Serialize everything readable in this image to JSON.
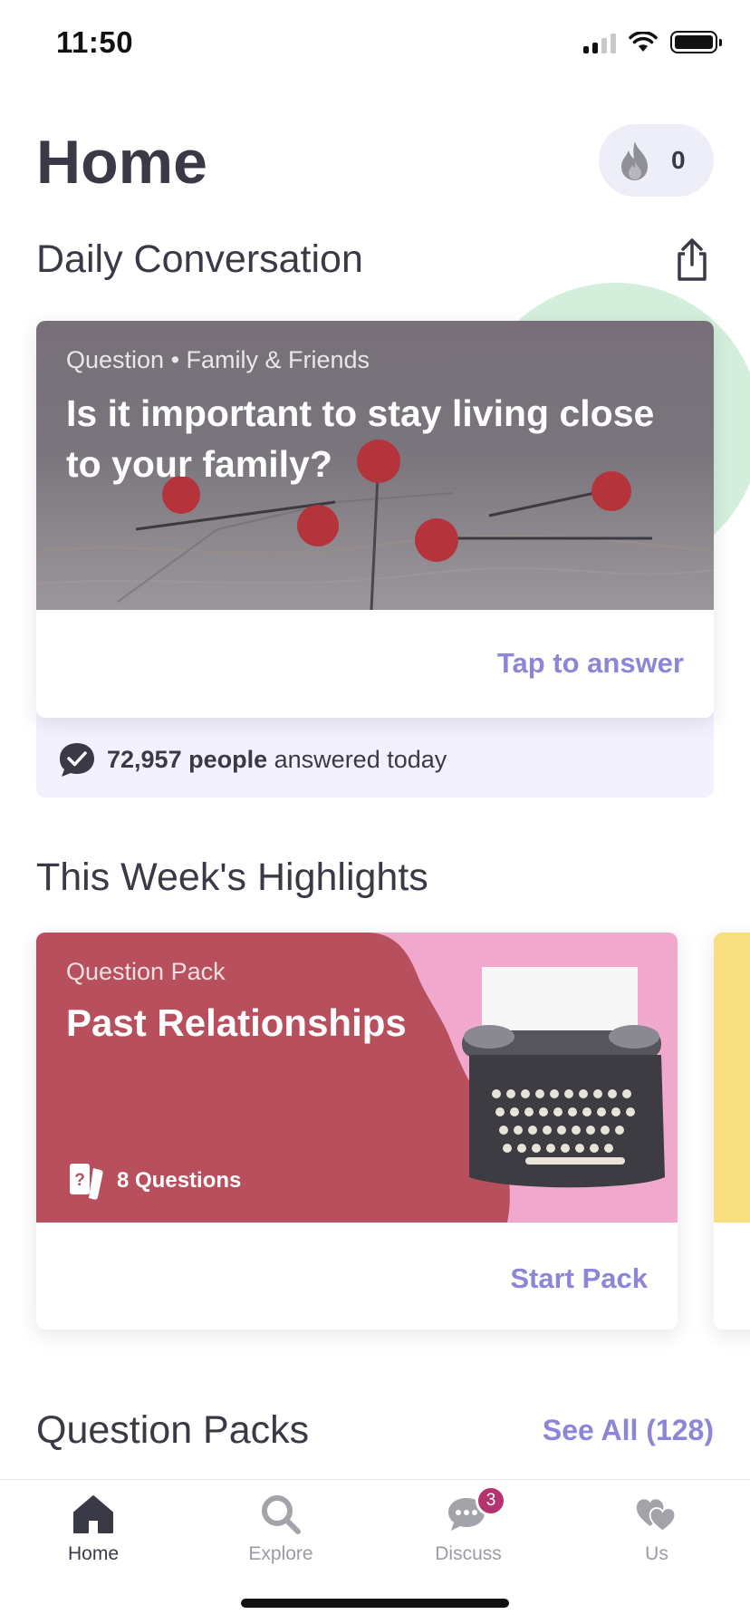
{
  "status_bar": {
    "time": "11:50"
  },
  "header": {
    "title": "Home",
    "streak_count": "0"
  },
  "daily": {
    "section_title": "Daily Conversation",
    "meta": "Question • Family & Friends",
    "question": "Is it important to stay living close to your family?",
    "cta": "Tap to answer",
    "answered_count": "72,957",
    "answered_unit": "people",
    "answered_suffix": "answered today"
  },
  "highlights": {
    "section_title": "This Week's Highlights",
    "card": {
      "type": "Question Pack",
      "title": "Past Relationships",
      "count": "8 Questions",
      "cta": "Start Pack"
    }
  },
  "packs": {
    "section_title": "Question Packs",
    "see_all": "See All (128)"
  },
  "tab_bar": {
    "items": [
      {
        "label": "Home",
        "icon": "home-icon"
      },
      {
        "label": "Explore",
        "icon": "search-icon"
      },
      {
        "label": "Discuss",
        "icon": "chat-icon",
        "badge": "3"
      },
      {
        "label": "Us",
        "icon": "hearts-icon"
      }
    ]
  },
  "colors": {
    "accent": "#8d86d8",
    "badge": "#b5346f",
    "pack_card": "#b84f5d",
    "pack_bg": "#f0a8cc"
  }
}
